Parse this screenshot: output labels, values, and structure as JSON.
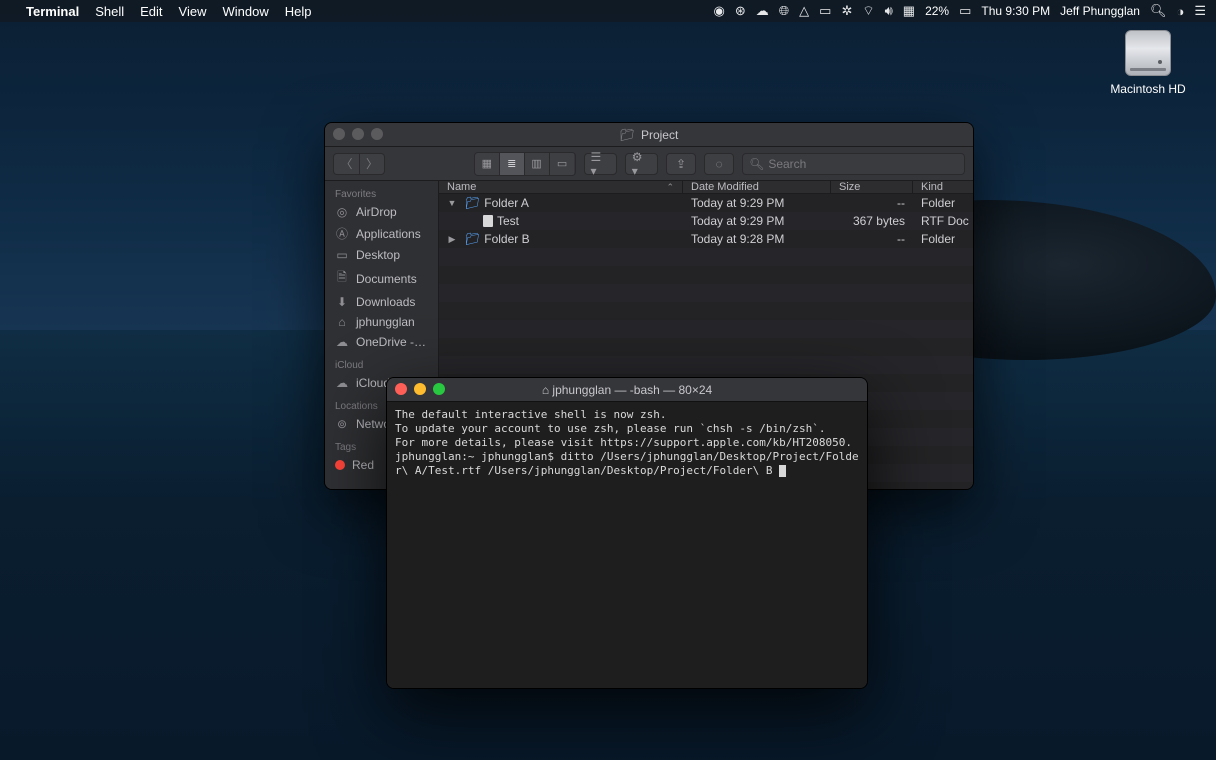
{
  "menubar": {
    "app": "Terminal",
    "items": [
      "Shell",
      "Edit",
      "View",
      "Window",
      "Help"
    ],
    "battery_pct": "22%",
    "clock": "Thu 9:30 PM",
    "user": "Jeff Phungglan"
  },
  "desktop": {
    "hd_label": "Macintosh HD"
  },
  "finder": {
    "title": "Project",
    "search_placeholder": "Search",
    "columns": {
      "name": "Name",
      "date": "Date Modified",
      "size": "Size",
      "kind": "Kind"
    },
    "sidebar": {
      "favorites_label": "Favorites",
      "favorites": [
        "AirDrop",
        "Applications",
        "Desktop",
        "Documents",
        "Downloads",
        "jphungglan",
        "OneDrive -…"
      ],
      "icloud_label": "iCloud",
      "icloud": [
        "iCloud …"
      ],
      "locations_label": "Locations",
      "locations": [
        "Netwo…"
      ],
      "tags_label": "Tags",
      "tags": [
        {
          "name": "Red",
          "color": "#ff453a"
        }
      ]
    },
    "rows": [
      {
        "disclosure": "▼",
        "icon": "folder",
        "indent": 0,
        "name": "Folder A",
        "date": "Today at 9:29 PM",
        "size": "--",
        "kind": "Folder"
      },
      {
        "disclosure": "",
        "icon": "file",
        "indent": 1,
        "name": "Test",
        "date": "Today at 9:29 PM",
        "size": "367 bytes",
        "kind": "RTF Doc"
      },
      {
        "disclosure": "▶",
        "icon": "folder",
        "indent": 0,
        "name": "Folder B",
        "date": "Today at 9:28 PM",
        "size": "--",
        "kind": "Folder"
      }
    ]
  },
  "terminal": {
    "title": "jphungglan — -bash — 80×24",
    "lines": [
      "The default interactive shell is now zsh.",
      "To update your account to use zsh, please run `chsh -s /bin/zsh`.",
      "For more details, please visit https://support.apple.com/kb/HT208050.",
      "jphungglan:~ jphungglan$ ditto /Users/jphungglan/Desktop/Project/Folder\\ A/Test.rtf /Users/jphungglan/Desktop/Project/Folder\\ B "
    ]
  }
}
